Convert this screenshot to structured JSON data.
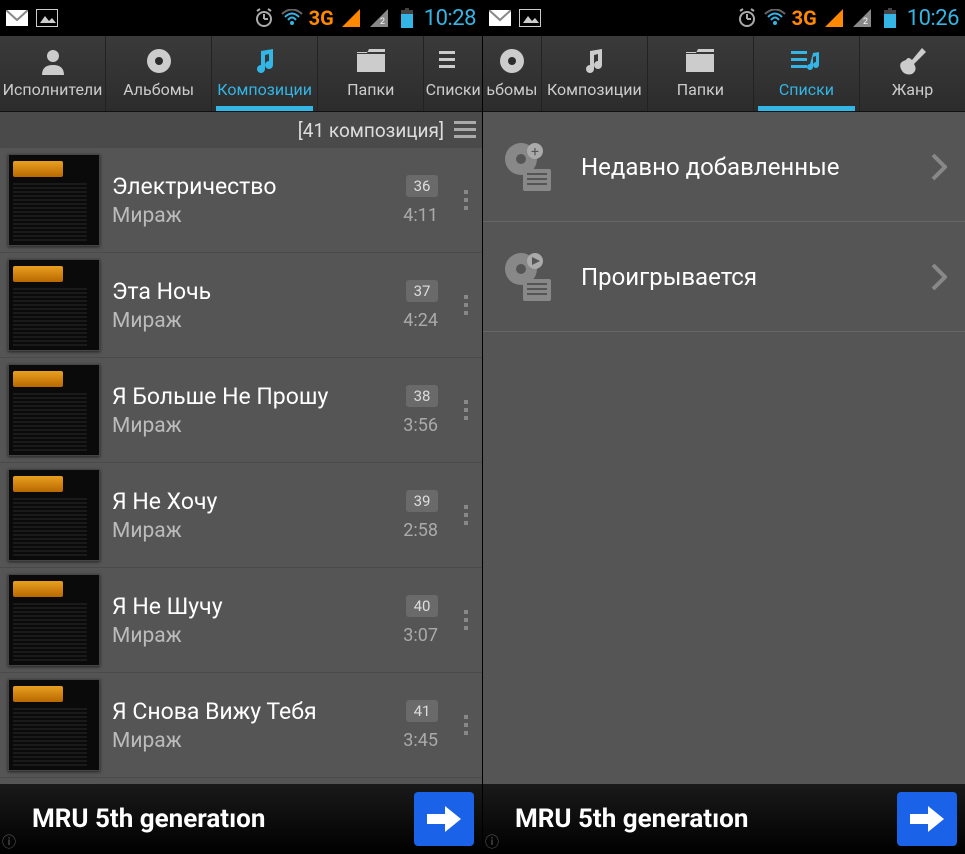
{
  "left": {
    "status": {
      "time": "10:28",
      "network": "3G"
    },
    "tabs": [
      {
        "label": "Исполнители",
        "icon": "person"
      },
      {
        "label": "Альбомы",
        "icon": "disc"
      },
      {
        "label": "Композиции",
        "icon": "note",
        "active": true
      },
      {
        "label": "Папки",
        "icon": "folder"
      },
      {
        "label": "Списки",
        "icon": "list"
      }
    ],
    "count": "[41 композиция]",
    "songs": [
      {
        "title": "Электричество",
        "artist": "Мираж",
        "num": "36",
        "dur": "4:11"
      },
      {
        "title": "Эта Ночь",
        "artist": "Мираж",
        "num": "37",
        "dur": "4:24"
      },
      {
        "title": "Я Больше Не Прошу",
        "artist": "Мираж",
        "num": "38",
        "dur": "3:56"
      },
      {
        "title": "Я Не Хочу",
        "artist": "Мираж",
        "num": "39",
        "dur": "2:58"
      },
      {
        "title": "Я Не Шучу",
        "artist": "Мираж",
        "num": "40",
        "dur": "3:07"
      },
      {
        "title": "Я Снова Вижу Тебя",
        "artist": "Мираж",
        "num": "41",
        "dur": "3:45"
      }
    ],
    "nowplaying": "MRU 5th generatıon"
  },
  "right": {
    "status": {
      "time": "10:26",
      "network": "3G"
    },
    "tabs": [
      {
        "label": "ьбомы",
        "icon": "disc"
      },
      {
        "label": "Композиции",
        "icon": "note"
      },
      {
        "label": "Папки",
        "icon": "folder"
      },
      {
        "label": "Списки",
        "icon": "list",
        "active": true
      },
      {
        "label": "Жанр",
        "icon": "guitar"
      }
    ],
    "playlists": [
      {
        "label": "Недавно добавленные",
        "icon": "recent"
      },
      {
        "label": "Проигрывается",
        "icon": "playing"
      }
    ],
    "nowplaying": "MRU 5th generatıon"
  }
}
